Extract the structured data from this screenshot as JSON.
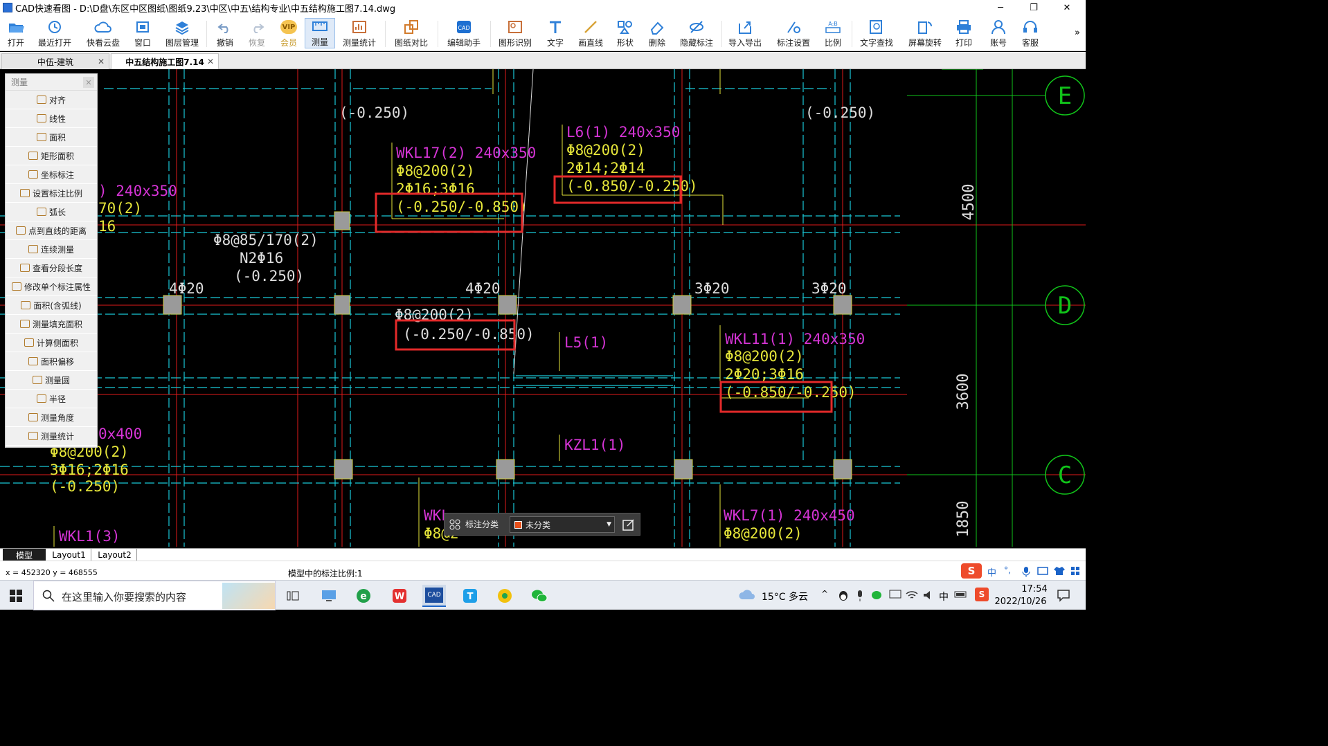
{
  "window": {
    "title": "CAD快速看图 - D:\\D盘\\东区中区图纸\\图纸9.23\\中区\\中五\\结构专业\\中五结构施工图7.14.dwg",
    "min": "─",
    "max": "❐",
    "close": "✕"
  },
  "ribbon": {
    "items": [
      {
        "label": "打开",
        "icon": "folder-open-icon"
      },
      {
        "label": "最近打开",
        "icon": "recent-icon"
      },
      {
        "label": "快看云盘",
        "icon": "cloud-icon"
      },
      {
        "label": "窗口",
        "icon": "window-icon"
      },
      {
        "label": "图层管理",
        "icon": "layers-icon"
      },
      {
        "label": "撤销",
        "icon": "undo-icon"
      },
      {
        "label": "恢复",
        "icon": "redo-icon"
      },
      {
        "label": "会员",
        "icon": "vip-icon",
        "badge": "VIP"
      },
      {
        "label": "测量",
        "icon": "measure-icon"
      },
      {
        "label": "测量统计",
        "icon": "measure-stats-icon"
      },
      {
        "label": "图纸对比",
        "icon": "compare-icon"
      },
      {
        "label": "编辑助手",
        "icon": "edit-assistant-icon"
      },
      {
        "label": "图形识别",
        "icon": "shape-recognize-icon"
      },
      {
        "label": "文字",
        "icon": "text-icon"
      },
      {
        "label": "画直线",
        "icon": "line-icon"
      },
      {
        "label": "形状",
        "icon": "shape-icon"
      },
      {
        "label": "删除",
        "icon": "eraser-icon"
      },
      {
        "label": "隐藏标注",
        "icon": "hide-annotation-icon"
      },
      {
        "label": "导入导出",
        "icon": "import-export-icon"
      },
      {
        "label": "标注设置",
        "icon": "annotation-settings-icon"
      },
      {
        "label": "比例",
        "icon": "scale-icon"
      },
      {
        "label": "文字查找",
        "icon": "text-search-icon"
      },
      {
        "label": "屏幕旋转",
        "icon": "rotate-screen-icon"
      },
      {
        "label": "打印",
        "icon": "print-icon"
      },
      {
        "label": "账号",
        "icon": "account-icon"
      },
      {
        "label": "客服",
        "icon": "support-icon"
      }
    ],
    "more": "»"
  },
  "tabs": [
    {
      "label": "中伍-建筑",
      "close": "✕"
    },
    {
      "label": "中五结构施工图7.14",
      "close": "✕"
    }
  ],
  "panel": {
    "title": "测量",
    "close": "✕",
    "items": [
      "对齐",
      "线性",
      "面积",
      "矩形面积",
      "坐标标注",
      "设置标注比例",
      "弧长",
      "点到直线的距离",
      "连续测量",
      "查看分段长度",
      "修改单个标注属性",
      "面积(含弧线)",
      "测量填充面积",
      "计算侧面积",
      "面积偏移",
      "测量圆",
      "半径",
      "测量角度",
      "测量统计"
    ]
  },
  "drawing": {
    "grid_bubbles": [
      "E",
      "D",
      "C"
    ],
    "dims": [
      "4500",
      "3600",
      "1850"
    ],
    "labels": {
      "elev_top_left": "(-0.250)",
      "elev_top_right": "(-0.250)",
      "wkl17": "WKL17(2) 240x350",
      "wkl17_stirrup": "Φ8@200(2)",
      "wkl17_bars": "2Φ16;3Φ16",
      "wkl17_elev": "(-0.250/-0.850)",
      "l6": "L6(1) 240x350",
      "l6_stirrup": "Φ8@200(2)",
      "l6_bars": "2Φ14;2Φ14",
      "l6_elev": "(-0.850/-0.250)",
      "left_partial1": ") 240x350",
      "left_partial2": "70(2)",
      "left_partial3": "16",
      "mid_stirrup": "Φ8@85/170(2)",
      "mid_n": "N2Φ16",
      "mid_elev": "(-0.250)",
      "c1": "4Φ20",
      "c2": "4Φ20",
      "c3": "3Φ20",
      "c4": "3Φ20",
      "b2_stirrup": "Φ8@200(2)",
      "b2_elev": "(-0.250/-0.850)",
      "l5": "L5(1)",
      "wkl11": "WKL11(1) 240x350",
      "wkl11_stirrup": "Φ8@200(2)",
      "wkl11_bars": "2Φ20;3Φ16",
      "wkl11_elev": "(-0.850/-0.250)",
      "kzl1": "KZL1(1)",
      "left_b1": "0x400",
      "left_b2": "Φ8@200(2)",
      "left_b3": "3Φ16;2Φ16",
      "left_b4": "(-0.250)",
      "wkl1": "WKL1(3)",
      "wkl_partial": "WKL",
      "wkl_partial_stirrup": "Φ8@2",
      "wkl7": "WKL7(1) 240x450",
      "wkl7_stirrup": "Φ8@200(2)"
    }
  },
  "catbar": {
    "label": "标注分类",
    "value": "未分类",
    "arrow": "▼"
  },
  "layouts": [
    "模型",
    "Layout1",
    "Layout2"
  ],
  "status": {
    "coords": "x = 452320  y = 468555",
    "scale": "模型中的标注比例:1"
  },
  "ime": {
    "lang": "中",
    "punct": "°,"
  },
  "taskbar": {
    "search_placeholder": "在这里输入你要搜索的内容",
    "weather": "15°C  多云",
    "time": "17:54",
    "date": "2022/10/26",
    "ime_lang": "中",
    "cad_label": "CAD"
  }
}
